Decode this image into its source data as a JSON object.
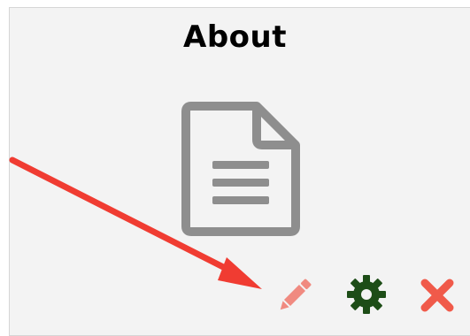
{
  "card": {
    "title": "About"
  },
  "icons": {
    "document": "document-icon",
    "edit": "pencil-icon",
    "settings": "gear-icon",
    "delete": "close-icon"
  },
  "colors": {
    "card_background": "#f3f3f3",
    "document_icon": "#8e8e8e",
    "edit_icon": "#f08a80",
    "settings_icon": "#1d4d17",
    "delete_icon": "#f05a4a",
    "annotation_arrow": "#f03c32"
  }
}
